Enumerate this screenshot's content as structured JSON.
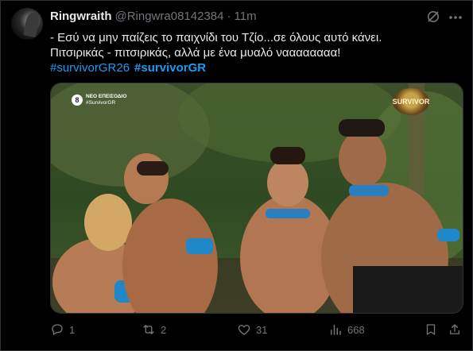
{
  "tweet": {
    "author_name": "Ringwraith",
    "handle": "@Ringwra08142384",
    "separator": "·",
    "time": "11m",
    "text_line_1": "- Εσύ να μην παίζεις το παιχνίδι του Τζίο...σε όλους αυτό κάνει.",
    "text_line_2": "Πιτσιρικάς - πιτσιρικάς, αλλά με ένα μυαλό ναααααααα!",
    "hashtag_1": "#survivorGR26",
    "hashtag_2": "#survivorGR"
  },
  "media": {
    "badge_number": "8",
    "badge_title": "ΝΕΟ ΕΠΕΙΣΟΔΙΟ",
    "badge_tag": "#SurvivorGR",
    "logo_text": "SURVIVOR"
  },
  "actions": {
    "reply_count": "1",
    "repost_count": "2",
    "like_count": "31",
    "views_count": "668"
  },
  "colors": {
    "background": "#000000",
    "text": "#e7e9ea",
    "secondary": "#71767b",
    "link": "#1d9bf0",
    "border": "#2f3336"
  },
  "icons": [
    "grok-icon",
    "more-icon",
    "reply-icon",
    "repost-icon",
    "like-icon",
    "views-icon",
    "bookmark-icon",
    "share-icon"
  ]
}
